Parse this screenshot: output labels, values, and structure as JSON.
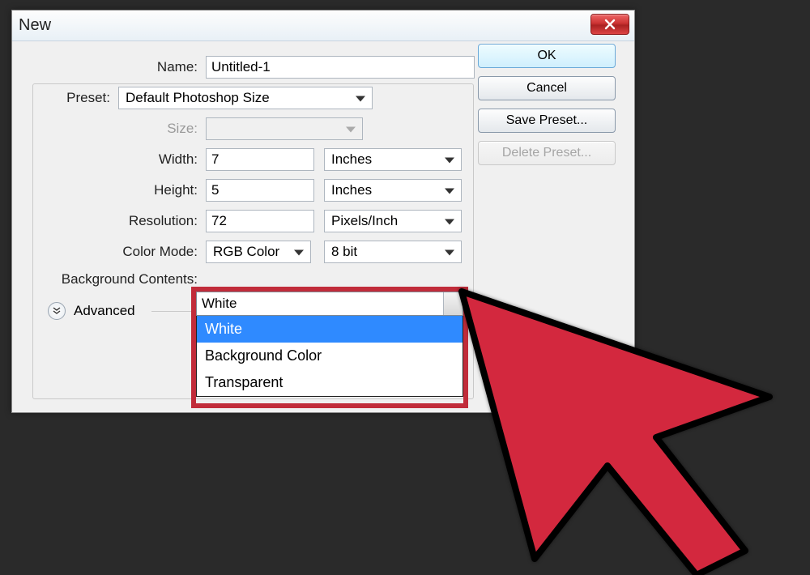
{
  "dialog": {
    "title": "New"
  },
  "labels": {
    "name": "Name:",
    "preset": "Preset:",
    "size": "Size:",
    "width": "Width:",
    "height": "Height:",
    "resolution": "Resolution:",
    "color_mode": "Color Mode:",
    "bg_contents": "Background Contents:",
    "advanced": "Advanced"
  },
  "fields": {
    "name": "Untitled-1",
    "preset": "Default Photoshop Size",
    "size": "",
    "width": "7",
    "width_unit": "Inches",
    "height": "5",
    "height_unit": "Inches",
    "resolution": "72",
    "resolution_unit": "Pixels/Inch",
    "color_mode": "RGB Color",
    "color_depth": "8 bit",
    "bg_selected": "White"
  },
  "bg_options": [
    "White",
    "Background Color",
    "Transparent"
  ],
  "buttons": {
    "ok": "OK",
    "cancel": "Cancel",
    "save_preset": "Save Preset...",
    "delete_preset": "Delete Preset..."
  }
}
